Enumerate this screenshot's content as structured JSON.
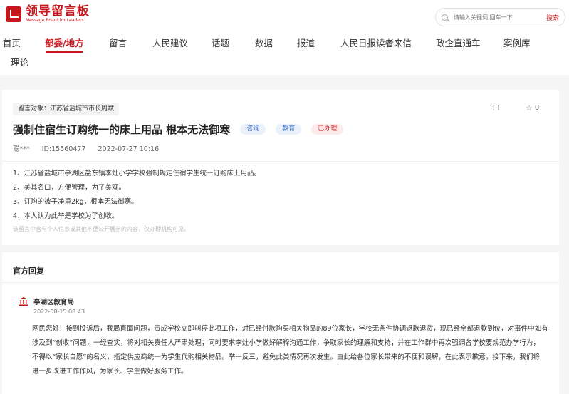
{
  "brand": {
    "title": "领导留言板",
    "subtitle": "Message Board for Leaders"
  },
  "search": {
    "placeholder": "请输入关键词 回车一下",
    "button_label": "搜索"
  },
  "nav": {
    "items": [
      "首页",
      "部委/地方",
      "留言",
      "人民建议",
      "话题",
      "数据",
      "报道",
      "人民日报读者来信",
      "政企直通车",
      "案例库",
      "理论"
    ],
    "active_index": 1
  },
  "message": {
    "target_label": "留言对象：江苏省盐城市市长周斌",
    "title": "强制住宿生订购统一的床上用品 根本无法御寒",
    "tags": [
      "咨询",
      "教育",
      "已办理"
    ],
    "author": "聪***",
    "id_label": "ID:15560477",
    "datetime": "2022-07-27 10:16",
    "font_size_icon_label": "TT",
    "favorite_count": "0",
    "content_lines": [
      "1、江苏省盐城市亭湖区盐东镇李灶小学学校强制规定住宿学生统一订购床上用品。",
      "2、美其名曰，方便管理，为了美观。",
      "3、订购的被子净重2kg，根本无法御寒。",
      "4、本人认为此举是学校为了创收。"
    ],
    "disclaimer": "该留言中含有个人信息或其他不便公开展示的内容，仅办理机构可见。"
  },
  "reply": {
    "heading": "官方回复",
    "org": "亭湖区教育局",
    "datetime": "2022-08-15 08:43",
    "lines": [
      "网民您好！接到投诉后，我局直面问题，责成学校立即叫停此项工作，对已经付款购买相关物品的89位家长，学校无条件协调退款退货，现已经全部退款到位，对事件中如有",
      "涉及到“创收”问题，一经查实，将对相关责任人严肃处理；同时要求李灶小学做好解释沟通工作，争取家长的理解和支持；并在工作群中再次强调各学校要规范办学行为，",
      "不得以“家长自愿”的名义，指定供应商统一为学生代购相关物品。举一反三，避免此类情况再次发生。由此给各位家长带来的不便和误解，在此表示歉意。接下来，我们将",
      "进一步改进工作作风，为家长、学生做好服务工作。"
    ]
  },
  "colors": {
    "brand_red": "#c8161d",
    "tag_blue": "#4a78c2",
    "tag_red": "#d2343a"
  }
}
